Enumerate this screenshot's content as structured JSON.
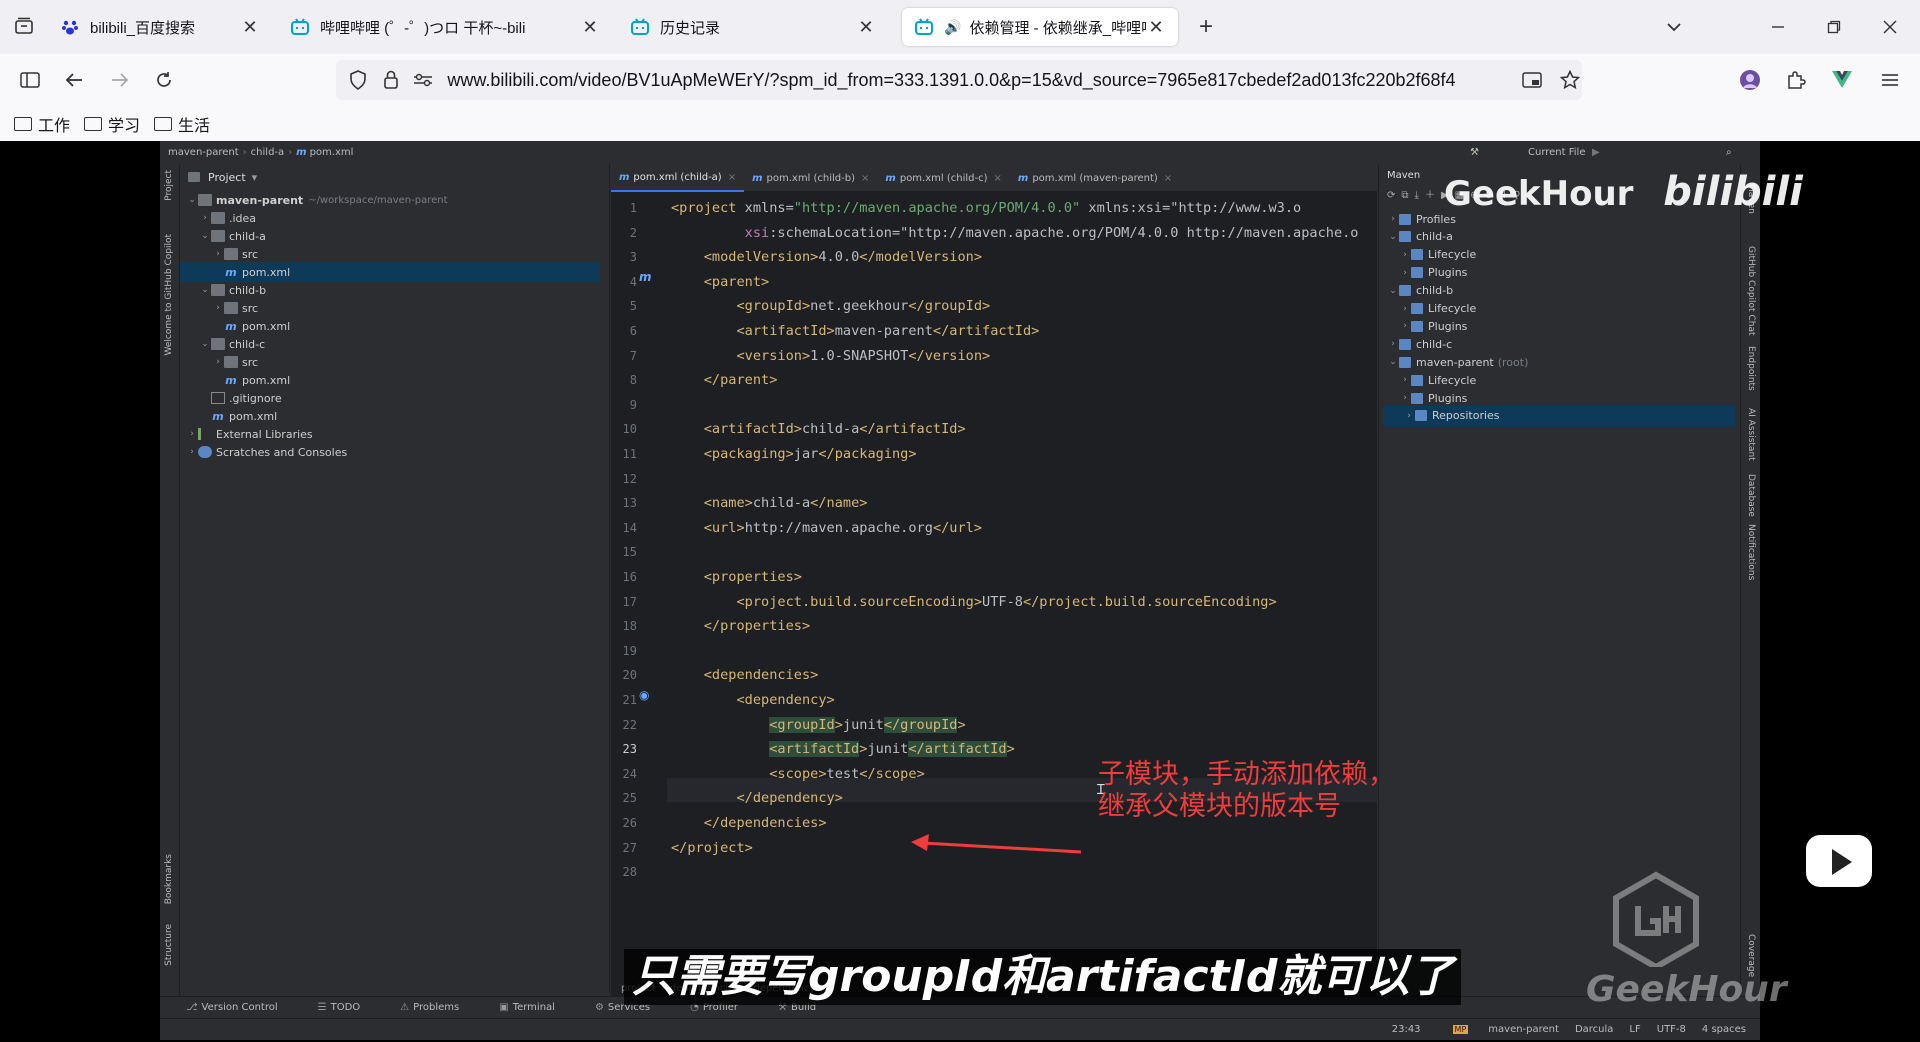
{
  "browser": {
    "tabs": [
      {
        "title": "bilibili_百度搜索",
        "icon": "baidu-paw-icon",
        "active": false
      },
      {
        "title": "哔哩哔哩 (゜-゜)つロ 干杯~-bili",
        "icon": "bilibili-tv-icon",
        "active": false
      },
      {
        "title": "历史记录",
        "icon": "bilibili-tv-icon",
        "active": false
      },
      {
        "title": "依赖管理 - 依赖继承_哔哩哔",
        "icon": "bilibili-tv-icon",
        "active": true
      }
    ],
    "url": "www.bilibili.com/video/BV1uApMeWErY/?spm_id_from=333.1391.0.0&p=15&vd_source=7965e817cbedef2ad013fc220b2f68f4",
    "bookmarks": [
      "工作",
      "学习",
      "生活"
    ],
    "accent_green": "#41b883"
  },
  "ide": {
    "breadcrumb": [
      "maven-parent",
      "child-a",
      "pom.xml"
    ],
    "toolbar_right": "Current File",
    "project_panel_title": "Project",
    "project_tree": [
      {
        "label": "maven-parent",
        "suffix": "~/workspace/maven-parent",
        "depth": 0,
        "type": "folder",
        "expanded": true
      },
      {
        "label": ".idea",
        "depth": 1,
        "type": "folder",
        "expanded": false
      },
      {
        "label": "child-a",
        "depth": 1,
        "type": "folder",
        "expanded": true
      },
      {
        "label": "src",
        "depth": 2,
        "type": "folder",
        "expanded": false
      },
      {
        "label": "pom.xml",
        "depth": 2,
        "type": "maven",
        "selected": true
      },
      {
        "label": "child-b",
        "depth": 1,
        "type": "folder",
        "expanded": true
      },
      {
        "label": "src",
        "depth": 2,
        "type": "folder",
        "expanded": false
      },
      {
        "label": "pom.xml",
        "depth": 2,
        "type": "maven"
      },
      {
        "label": "child-c",
        "depth": 1,
        "type": "folder",
        "expanded": true
      },
      {
        "label": "src",
        "depth": 2,
        "type": "folder",
        "expanded": false
      },
      {
        "label": "pom.xml",
        "depth": 2,
        "type": "maven"
      },
      {
        "label": ".gitignore",
        "depth": 1,
        "type": "file"
      },
      {
        "label": "pom.xml",
        "depth": 1,
        "type": "maven"
      },
      {
        "label": "External Libraries",
        "depth": 0,
        "type": "lib",
        "expanded": false
      },
      {
        "label": "Scratches and Consoles",
        "depth": 0,
        "type": "scratch",
        "expanded": false
      }
    ],
    "editor_tabs": [
      {
        "label": "pom.xml (child-a)",
        "active": true
      },
      {
        "label": "pom.xml (child-b)",
        "active": false
      },
      {
        "label": "pom.xml (child-c)",
        "active": false
      },
      {
        "label": "pom.xml (maven-parent)",
        "active": false
      }
    ],
    "code_lines": [
      "<project xmlns=\"http://maven.apache.org/POM/4.0.0\" xmlns:xsi=\"http://www.w3.o",
      "         xsi:schemaLocation=\"http://maven.apache.org/POM/4.0.0 http://maven.apache.o",
      "    <modelVersion>4.0.0</modelVersion>",
      "    <parent>",
      "        <groupId>net.geekhour</groupId>",
      "        <artifactId>maven-parent</artifactId>",
      "        <version>1.0-SNAPSHOT</version>",
      "    </parent>",
      "",
      "    <artifactId>child-a</artifactId>",
      "    <packaging>jar</packaging>",
      "",
      "    <name>child-a</name>",
      "    <url>http://maven.apache.org</url>",
      "",
      "    <properties>",
      "        <project.build.sourceEncoding>UTF-8</project.build.sourceEncoding>",
      "    </properties>",
      "",
      "    <dependencies>",
      "        <dependency>",
      "            <groupId>junit</groupId>",
      "            <artifactId>junit</artifactId>",
      "            <scope>test</scope>",
      "        </dependency>",
      "    </dependencies>",
      "</project>",
      ""
    ],
    "current_line": 23,
    "annotation": [
      "子模块，手动添加依赖，不需要写版本号了",
      "继承父模块的版本号"
    ],
    "bottom_breadcrumb": [
      "project",
      "dependencies",
      "dependency"
    ],
    "maven_panel_title": "Maven",
    "maven_tree": [
      {
        "label": "Profiles",
        "depth": 0
      },
      {
        "label": "child-a",
        "depth": 0,
        "expanded": true
      },
      {
        "label": "Lifecycle",
        "depth": 1
      },
      {
        "label": "Plugins",
        "depth": 1
      },
      {
        "label": "child-b",
        "depth": 0,
        "expanded": true
      },
      {
        "label": "Lifecycle",
        "depth": 1
      },
      {
        "label": "Plugins",
        "depth": 1
      },
      {
        "label": "child-c",
        "depth": 0
      },
      {
        "label": "maven-parent",
        "suffix": "(root)",
        "depth": 0,
        "expanded": true
      },
      {
        "label": "Lifecycle",
        "depth": 1
      },
      {
        "label": "Plugins",
        "depth": 1
      },
      {
        "label": "Repositories",
        "depth": 1,
        "selected": true
      }
    ],
    "left_strip": [
      "Project",
      "Welcome to GitHub Copilot",
      "Bookmarks",
      "Structure"
    ],
    "right_strip": [
      "Maven",
      "GitHub Copilot Chat",
      "Endpoints",
      "AI Assistant",
      "Database",
      "Notifications",
      "Coverage"
    ],
    "bottom_tools": [
      "Version Control",
      "TODO",
      "Problems",
      "Terminal",
      "Services",
      "Profiler",
      "Build"
    ],
    "status": {
      "position": "23:43",
      "project": "maven-parent",
      "theme": "Darcula",
      "line_sep": "LF",
      "encoding": "UTF-8",
      "indent": "4 spaces"
    }
  },
  "overlay": {
    "subtitle": "只需要写groupId和artifactId就可以了",
    "watermark_top": "GeekHour",
    "watermark_logo": "bilibili",
    "watermark_bottom": "GeekHour"
  }
}
